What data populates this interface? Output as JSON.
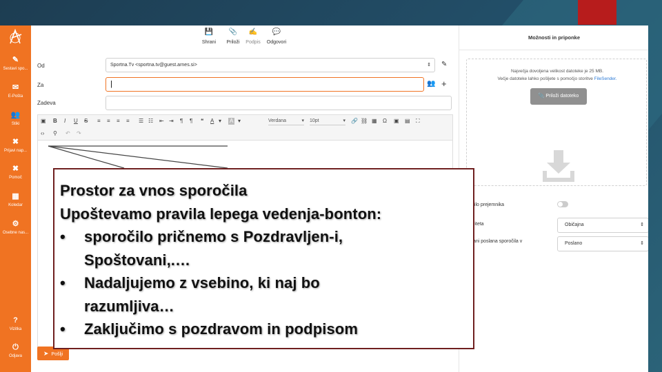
{
  "sidebar": {
    "items": [
      {
        "icon": "edit-icon",
        "glyph": "✎",
        "label": "Sestavi spo..."
      },
      {
        "icon": "envelope-icon",
        "glyph": "✉",
        "label": "E-Pošta"
      },
      {
        "icon": "contacts-icon",
        "glyph": "👥",
        "label": "Stiki"
      },
      {
        "icon": "report-icon",
        "glyph": "✖",
        "label": "Prijavi nap..."
      },
      {
        "icon": "help-circle-icon",
        "glyph": "✖",
        "label": "Pomoč"
      },
      {
        "icon": "calendar-icon",
        "glyph": "▦",
        "label": "Koledar"
      },
      {
        "icon": "gear-icon",
        "glyph": "⚙",
        "label": "Osebne nas..."
      },
      {
        "icon": "question-icon",
        "glyph": "?",
        "label": "Vizitka"
      },
      {
        "icon": "power-icon",
        "glyph": "⏻",
        "label": "Odjava"
      }
    ]
  },
  "toolbar": {
    "save": "Shrani",
    "attach": "Priloži",
    "signature": "Podpis",
    "reply": "Odgovori"
  },
  "form": {
    "from_label": "Od",
    "from_value": "Sportna.Tv <sportna.tv@guest.arnes.si>",
    "to_label": "Za",
    "to_value": "|",
    "subject_label": "Zadeva"
  },
  "editor": {
    "font_name": "Verdana",
    "font_size": "10pt"
  },
  "send": {
    "label": "Pošlji"
  },
  "right_panel": {
    "title": "Možnosti in priponke",
    "info_line1": "Največja dovoljena velikost datoteke je 25 MB.",
    "info_line2": "Večje datoteke lahko pošljete s pomočjo storitve",
    "info_link": "FileSender.",
    "attach_button": "Priloži datoteko",
    "receipt_label": "dilo prejemnika",
    "priority_label": "riteta",
    "priority_value": "Običajna",
    "sent_label": "ani poslana sporočila v",
    "sent_value": "Poslano"
  },
  "callout": {
    "line1": "Prostor za vnos sporočila",
    "line2": "Upoštevamo pravila lepega vedenja-bonton:",
    "bullet": "•",
    "item1_a": "sporočilo pričnemo s Pozdravljen-i,",
    "item1_b": "Spoštovani,.…",
    "item2_a": "Nadaljujemo z vsebino, ki naj bo",
    "item2_b": "razumljiva…",
    "item3": "Zaključimo s pozdravom in podpisom"
  }
}
